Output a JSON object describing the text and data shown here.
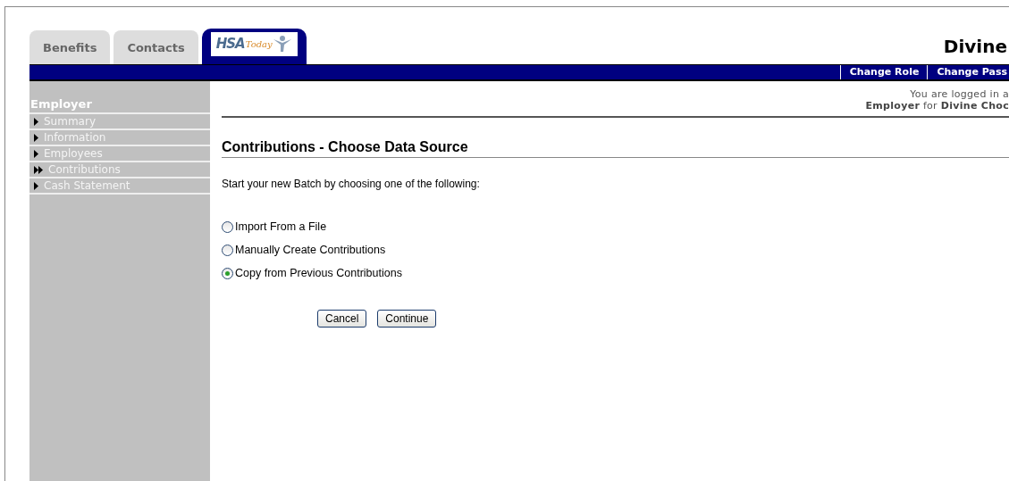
{
  "tabs": [
    {
      "label": "Benefits",
      "kind": "text",
      "selected": false
    },
    {
      "label": "Contacts",
      "kind": "text",
      "selected": false
    },
    {
      "kind": "logo",
      "logo_main": "HSA",
      "logo_sub": "Today",
      "selected": true
    }
  ],
  "company_title": "Divine",
  "nav_links": [
    "Change Role",
    "Change Pass"
  ],
  "login_info": {
    "line_1": "You are logged in a",
    "line_2": "**Employer** for **Divine Choc**"
  },
  "sidebar": {
    "heading": "Employer",
    "items": [
      {
        "label": "Summary",
        "selected": false
      },
      {
        "label": "Information",
        "selected": false
      },
      {
        "label": "Employees",
        "selected": false
      },
      {
        "label": "Contributions",
        "selected": true
      },
      {
        "label": "Cash Statement",
        "selected": false
      }
    ]
  },
  "page_title": "Contributions - Choose Data Source",
  "instruction": "Start your new Batch by choosing one of the following:",
  "options": [
    {
      "label": "Import From a File",
      "selected": false
    },
    {
      "label": "Manually Create Contributions",
      "selected": false
    },
    {
      "label": "Copy from Previous Contributions",
      "selected": true
    }
  ],
  "buttons": [
    "Cancel",
    "Continue"
  ]
}
